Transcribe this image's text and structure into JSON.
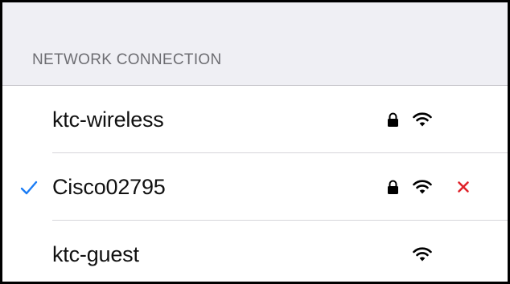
{
  "section": {
    "title": "NETWORK CONNECTION"
  },
  "networks": [
    {
      "name": "ktc-wireless",
      "connected": false,
      "secured": true,
      "signal": "full"
    },
    {
      "name": "Cisco02795",
      "connected": true,
      "secured": true,
      "signal": "full",
      "can_forget": true
    },
    {
      "name": "ktc-guest",
      "connected": false,
      "secured": false,
      "signal": "full"
    }
  ],
  "icons": {
    "check": "checkmark-icon",
    "lock": "lock-icon",
    "wifi": "wifi-icon",
    "forget": "close-icon"
  },
  "colors": {
    "accent": "#1a7cf5",
    "danger": "#e0232b",
    "header_bg": "#efeff4",
    "header_text": "#6d6d72"
  }
}
